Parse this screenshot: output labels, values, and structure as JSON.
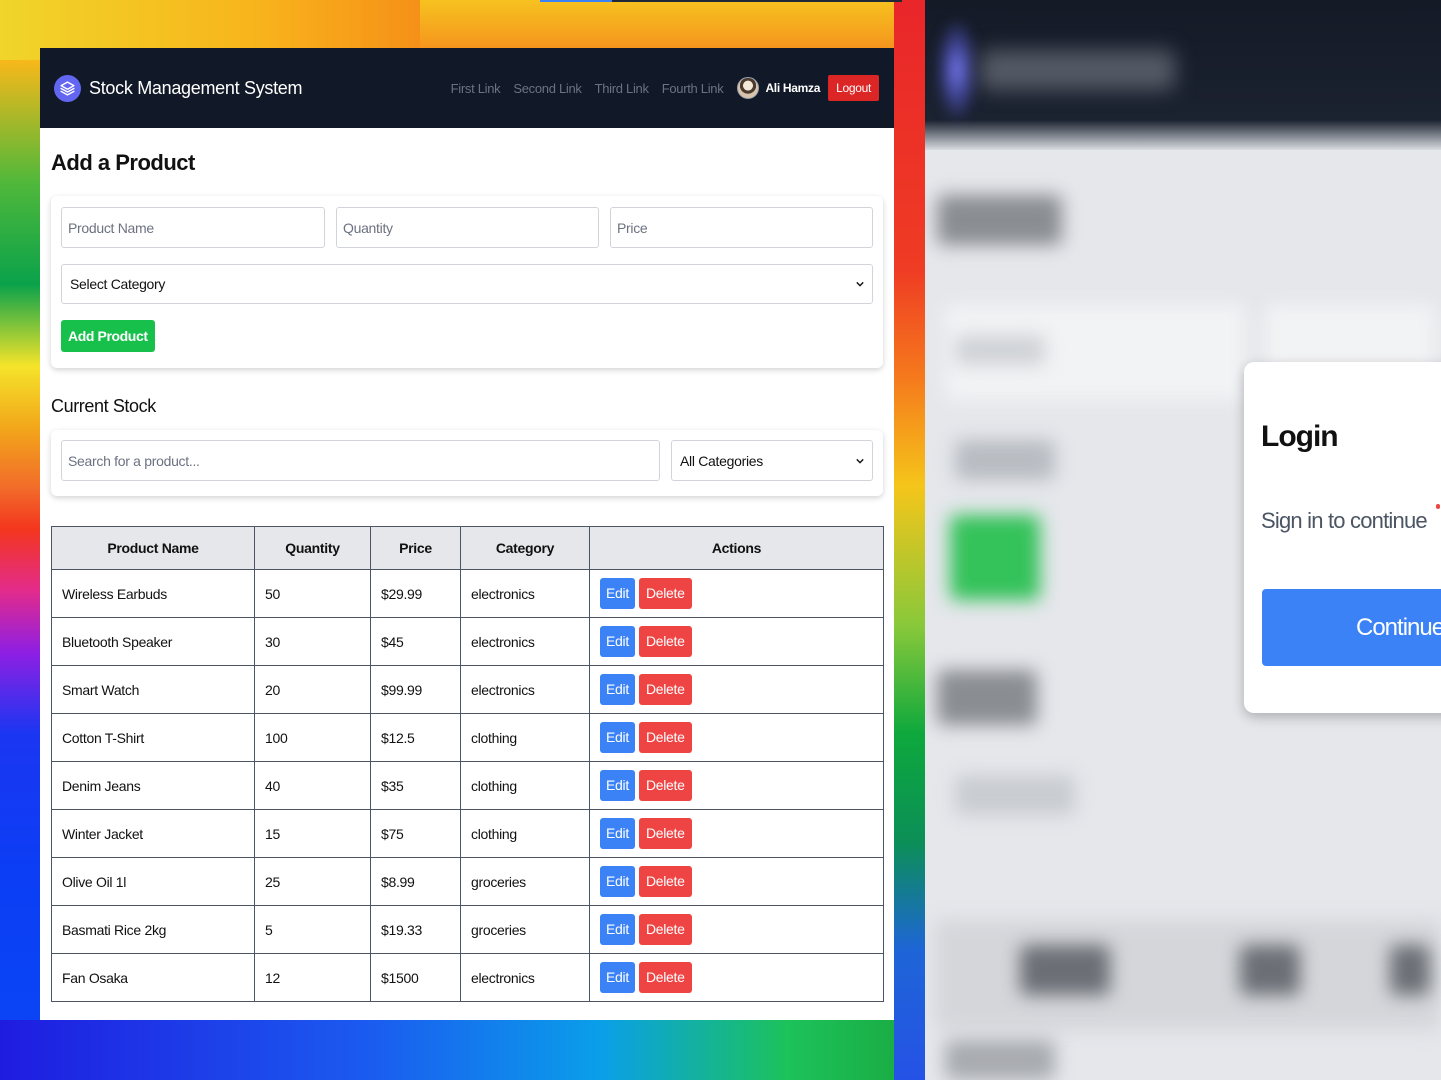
{
  "navbar": {
    "brand": "Stock Management System",
    "links": [
      "First Link",
      "Second Link",
      "Third Link",
      "Fourth Link"
    ],
    "user_name": "Ali Hamza",
    "logout_label": "Logout"
  },
  "add_product": {
    "title": "Add a Product",
    "name_placeholder": "Product Name",
    "quantity_placeholder": "Quantity",
    "price_placeholder": "Price",
    "category_selected": "Select Category",
    "submit_label": "Add Product"
  },
  "current_stock": {
    "title": "Current Stock",
    "search_placeholder": "Search for a product...",
    "filter_selected": "All Categories"
  },
  "table": {
    "headers": [
      "Product Name",
      "Quantity",
      "Price",
      "Category",
      "Actions"
    ],
    "edit_label": "Edit",
    "delete_label": "Delete",
    "rows": [
      {
        "name": "Wireless Earbuds",
        "quantity": "50",
        "price": "$29.99",
        "category": "electronics"
      },
      {
        "name": "Bluetooth Speaker",
        "quantity": "30",
        "price": "$45",
        "category": "electronics"
      },
      {
        "name": "Smart Watch",
        "quantity": "20",
        "price": "$99.99",
        "category": "electronics"
      },
      {
        "name": "Cotton T-Shirt",
        "quantity": "100",
        "price": "$12.5",
        "category": "clothing"
      },
      {
        "name": "Denim Jeans",
        "quantity": "40",
        "price": "$35",
        "category": "clothing"
      },
      {
        "name": "Winter Jacket",
        "quantity": "15",
        "price": "$75",
        "category": "clothing"
      },
      {
        "name": "Olive Oil 1l",
        "quantity": "25",
        "price": "$8.99",
        "category": "groceries"
      },
      {
        "name": "Basmati Rice 2kg",
        "quantity": "5",
        "price": "$19.33",
        "category": "groceries"
      },
      {
        "name": "Fan Osaka",
        "quantity": "12",
        "price": "$1500",
        "category": "electronics"
      }
    ]
  },
  "login_card": {
    "title": "Login",
    "subtitle": "Sign in to continue",
    "button_label": "Continue with G"
  },
  "colors": {
    "navbar_bg": "#111827",
    "logo": "#6366f1",
    "logout": "#dc2626",
    "add_button": "#16c04a",
    "edit_button": "#3b82f6",
    "delete_button": "#ef4444"
  },
  "icons": {
    "logo": "layers-icon",
    "select_arrow": "chevron-down-icon",
    "avatar": "user-avatar"
  }
}
